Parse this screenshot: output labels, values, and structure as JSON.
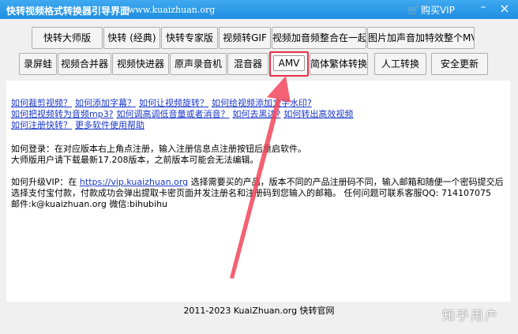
{
  "window": {
    "title": "快转视频格式转换器引导界面",
    "url": "www.kuaizhuan.org",
    "cart_label": "购买VIP",
    "minimize_glyph": "–",
    "close_glyph": "×"
  },
  "toolbar_row1": [
    {
      "label": "快转大师版"
    },
    {
      "label": "快转 (经典)"
    },
    {
      "label": "快转专家版"
    },
    {
      "label": "视频转GIF"
    },
    {
      "label": "视频加音频整合在一起"
    },
    {
      "label": "图片加声音加特效整个MV"
    }
  ],
  "toolbar_row2": [
    {
      "label": "录屏蛙"
    },
    {
      "label": "视频合并器"
    },
    {
      "label": "视频快进器"
    },
    {
      "label": "原声录音机"
    },
    {
      "label": "混音器"
    },
    {
      "label": "AMV"
    },
    {
      "label": "简体繁体转换"
    },
    {
      "label": "人工转换"
    },
    {
      "label": "安全更新"
    }
  ],
  "help_links": [
    "如何裁剪视频？",
    "如何添加字幕？",
    "如何让视频旋转？",
    "如何给视频添加文字水印?",
    "如何把视频转为音频mp3?",
    "如何调高调低音量或者消音？",
    "如何去黑边?",
    "如何转出高效视频",
    "如何注册快转？",
    "更多软件使用帮助"
  ],
  "login": {
    "line1": "如何登录：在对应版本右上角点注册，输入注册信息点注册按钮后重启软件。",
    "line2": "大师版用户请下载最新17.208版本，之前版本可能会无法编辑。"
  },
  "upgrade": {
    "prefix": "如何升级VIP：在",
    "link": "https://vip.kuaizhuan.org",
    "text": "选择需要买的产品，版本不同的产品注册码不同，输入邮箱和随便一个密码提交后选择支付宝付款，付款成功会弹出提取卡密页面并发注册名和注册码到您输入的邮箱。 任何问题可联系客服QQ: 714107075",
    "contact": "邮件:k@kuaizhuan.org 微信:bihubihu"
  },
  "footer": "2011-2023 KuaiZhuan.org 快转官网",
  "watermark": "知乎用户",
  "colors": {
    "titlebar": "#1e8ee0",
    "link": "#1a37c8",
    "highlight": "#e8324a"
  }
}
